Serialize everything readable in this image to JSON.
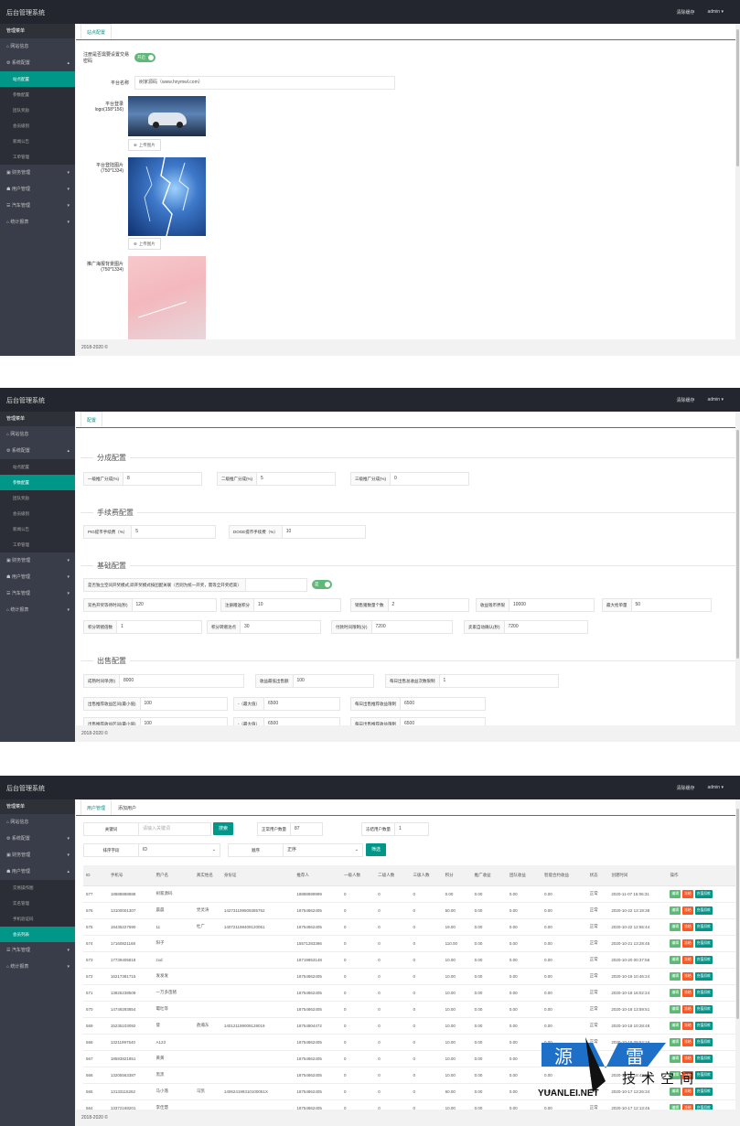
{
  "app_title": "后台管理系统",
  "topbar": {
    "clear_cache": "清除缓存",
    "user": "admin ▾"
  },
  "sidebar": {
    "title": "管理菜单",
    "site_info": "网站信息",
    "system": "系统配置",
    "system_items": [
      "站点配置",
      "参数配置",
      "团队奖励",
      "会员级别",
      "新闻公告",
      "工单管理"
    ],
    "finance": "财务管理",
    "users": "用户管理",
    "users_items": [
      "交易操作图",
      "实名管理",
      "手机验证码",
      "会员列表"
    ],
    "cars": "汽车管理",
    "stats": "统计报表",
    "arrow_up": "▴",
    "arrow_down": "▾"
  },
  "footer": "2018-2020 ©",
  "screen1": {
    "tab": "站点配置",
    "register_label": "注册是否需要设置交易密码",
    "register_switch": "开启",
    "name_label": "平台名称",
    "name_value": "树家源码（www.hnymwl.com）",
    "logo_label": "平台登录logo(158*156)",
    "upload": "上传图片",
    "bg_label": "平台登陆图片(750*1334)",
    "promo_label": "推广海报背景图片(750*1334)"
  },
  "screen2": {
    "tab": "配置",
    "sec_share": "分成配置",
    "share": [
      {
        "l": "一级推广分成(%)",
        "v": "8"
      },
      {
        "l": "二级推广分成(%)",
        "v": "5"
      },
      {
        "l": "三级推广分成(%)",
        "v": "0"
      }
    ],
    "sec_fee": "手续费配置",
    "fee": [
      {
        "l": "PIG提币手续费（%）",
        "v": "5"
      },
      {
        "l": "DOGE提币手续费（%）",
        "v": "10"
      }
    ],
    "sec_base": "基础配置",
    "base_switch_label": "是否独立空间开奖模式,即开奖模式按团配关联（否则为统一开奖，需等全开奖结束）",
    "base_switch": "是",
    "base1": [
      {
        "l": "双色开奖等待时间(秒)",
        "v": "120"
      },
      {
        "l": "注册赠送积分",
        "v": "10"
      },
      {
        "l": "销售猪数量个数",
        "v": "2"
      },
      {
        "l": "收益钱币界限",
        "v": "10000"
      },
      {
        "l": "最大抢单量",
        "v": "50"
      }
    ],
    "base2": [
      {
        "l": "积分转猪倍数",
        "v": "1"
      },
      {
        "l": "积分转赠池点",
        "v": "30"
      },
      {
        "l": "付款时间限制(分)",
        "v": "7200"
      },
      {
        "l": "卖家自动确认(秒)",
        "v": "7200"
      }
    ],
    "sec_sell": "出售配置",
    "sell1": [
      {
        "l": "成熟时间单(秒)",
        "v": "8000"
      },
      {
        "l": "收益最低出售额",
        "v": "100"
      },
      {
        "l": "每日出售总收益次数限制",
        "v": "1"
      }
    ],
    "sell2": [
      {
        "l": "出售推荐收益区间(最小值)",
        "v": "100"
      },
      {
        "l": "-（最大值）",
        "v": "6500"
      },
      {
        "l": "每日出售推荐收益限制",
        "v": "6500"
      }
    ],
    "sell3": [
      {
        "l": "出售推荐收益区间(最小值)",
        "v": "100"
      },
      {
        "l": "-（最大值）",
        "v": "6500"
      },
      {
        "l": "每日出售推荐收益限制",
        "v": "6500"
      }
    ]
  },
  "screen3": {
    "tabs": [
      "用户管理",
      "添加用户"
    ],
    "keyword_label": "关键词",
    "keyword_ph": "请输入关键词",
    "search_btn": "搜索",
    "normal_label": "正常用户数量",
    "normal_val": "87",
    "frozen_label": "冻结用户数量",
    "frozen_val": "1",
    "sort_label": "排序字段",
    "sort_val": "ID",
    "order_label": "顺序",
    "order_val": "正序",
    "filter_btn": "筛选",
    "headers": [
      "ID",
      "手机号",
      "用户名",
      "真实姓名",
      "身份证",
      "推荐人",
      "一级人数",
      "二级人数",
      "三级人数",
      "积分",
      "推广收益",
      "团队收益",
      "智能合约收益",
      "状态",
      "创建时间",
      "操作"
    ],
    "op_edit": "编辑",
    "op_freeze": "冻结",
    "op_reset": "充值扣款",
    "rows": [
      [
        "577",
        "18888888888",
        "树家源码",
        "",
        "",
        "18888899999",
        "0",
        "0",
        "0",
        "0.00",
        "0.00",
        "0.00",
        "0.00",
        "正常",
        "2020-11-07 15:06:31"
      ],
      [
        "576",
        "13100001307",
        "晨晨",
        "党灵涛",
        "142731199509385752",
        "18754862405",
        "0",
        "0",
        "0",
        "50.00",
        "0.00",
        "0.00",
        "0.00",
        "正常",
        "2020-10-22 13:19:38"
      ],
      [
        "575",
        "18435227690",
        "11",
        "杜广",
        "140721198409120051",
        "18754862405",
        "0",
        "0",
        "0",
        "19.00",
        "0.00",
        "0.00",
        "0.00",
        "正常",
        "2020-10-22 12:55:44"
      ],
      [
        "574",
        "17160821168",
        "阳子",
        "",
        "",
        "15571283396",
        "0",
        "0",
        "0",
        "110.00",
        "0.00",
        "0.00",
        "0.00",
        "正常",
        "2020-10-21 13:28:45"
      ],
      [
        "573",
        "17739405818",
        "zxd",
        "",
        "",
        "18719853148",
        "0",
        "0",
        "0",
        "10.00",
        "0.00",
        "0.00",
        "0.00",
        "正常",
        "2020-10-20 00:37:56"
      ],
      [
        "572",
        "16217381715",
        "发发发",
        "",
        "",
        "18754862405",
        "0",
        "0",
        "0",
        "10.00",
        "0.00",
        "0.00",
        "0.00",
        "正常",
        "2020-10-19 10:46:24"
      ],
      [
        "571",
        "13825238509",
        "一万多亩猪",
        "",
        "",
        "18754862405",
        "0",
        "0",
        "0",
        "10.00",
        "0.00",
        "0.00",
        "0.00",
        "正常",
        "2020-10-18 16:02:24"
      ],
      [
        "570",
        "14749293854",
        "電吐等",
        "",
        "",
        "18754862405",
        "0",
        "0",
        "0",
        "10.00",
        "0.00",
        "0.00",
        "0.00",
        "正常",
        "2020-10-18 13:59:51"
      ],
      [
        "569",
        "15235103092",
        "發",
        "敖瀚东",
        "140121199009128019",
        "18754804472",
        "0",
        "0",
        "0",
        "10.00",
        "0.00",
        "0.00",
        "0.00",
        "正常",
        "2020-10-18 10:28:48"
      ],
      [
        "568",
        "13211997540",
        "A123",
        "",
        "",
        "18754862405",
        "0",
        "0",
        "0",
        "10.00",
        "0.00",
        "0.00",
        "0.00",
        "正常",
        "2020-10-18 09:52:18"
      ],
      [
        "567",
        "18593821851",
        "黄黄",
        "",
        "",
        "18754862405",
        "0",
        "0",
        "0",
        "10.00",
        "0.00",
        "0.00",
        "0.00",
        "正常",
        "2020-10-17 20:12:51"
      ],
      [
        "566",
        "13205563387",
        "黑黑",
        "",
        "",
        "18754862405",
        "0",
        "0",
        "0",
        "10.00",
        "0.00",
        "0.00",
        "0.00",
        "正常",
        "2020-10-17 18:42:05"
      ],
      [
        "565",
        "13133115262",
        "马小落",
        "马凯",
        "140624199310100051X",
        "18754862405",
        "0",
        "0",
        "0",
        "60.00",
        "0.00",
        "0.00",
        "0.00",
        "正常",
        "2020-10-17 13:26:34"
      ],
      [
        "564",
        "13372168201",
        "李佳慧",
        "",
        "",
        "18754862405",
        "0",
        "0",
        "0",
        "10.00",
        "0.00",
        "0.00",
        "0.00",
        "正常",
        "2020-10-17 12:13:45"
      ]
    ]
  },
  "watermark": {
    "brand_left": "源",
    "brand_right": "雷",
    "sub": "技术空间",
    "site": "YUANLEI.NET"
  }
}
